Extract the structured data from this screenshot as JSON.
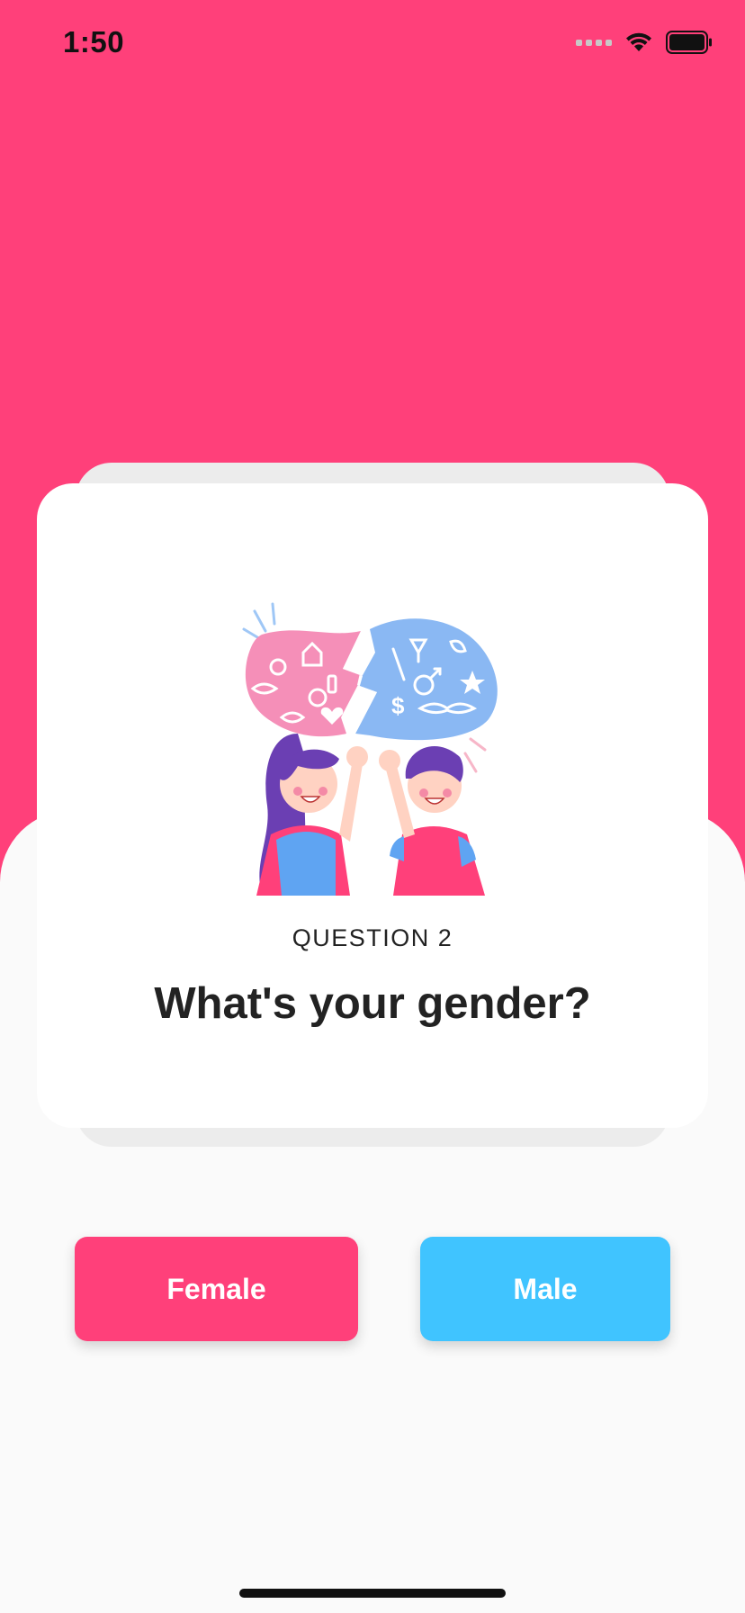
{
  "status_bar": {
    "time": "1:50",
    "icons": [
      "cellular-signal-icon",
      "wifi-icon",
      "battery-icon"
    ]
  },
  "colors": {
    "primary_pink": "#ff407a",
    "male_blue": "#40c4ff",
    "background": "#fafafa"
  },
  "question": {
    "label": "QUESTION 2",
    "title": "What's your gender?"
  },
  "answers": {
    "female_label": "Female",
    "male_label": "Male"
  }
}
